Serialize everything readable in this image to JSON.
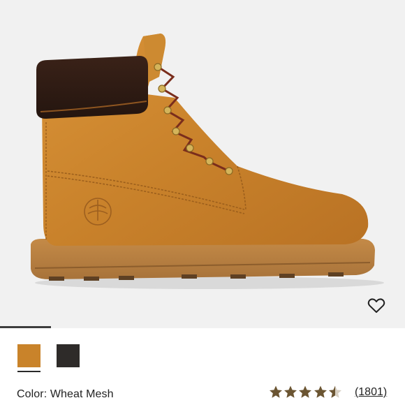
{
  "product": {
    "image_alt": "Wheat nubuck 6-inch boot with brown padded collar",
    "color_label": "Color:",
    "color_value": "Wheat Mesh"
  },
  "gallery": {
    "progress_fraction": 0.125
  },
  "swatches": [
    {
      "name": "Wheat",
      "color": "#c9832a",
      "selected": true
    },
    {
      "name": "Black",
      "color": "#2e2b29",
      "selected": false
    }
  ],
  "rating": {
    "stars": 4.5,
    "max": 5,
    "review_count": "(1801)"
  },
  "icons": {
    "wishlist": "heart-outline-icon",
    "star": "star-icon"
  },
  "colors": {
    "star": "#6b5532",
    "hero_bg": "#f1f1f1"
  }
}
